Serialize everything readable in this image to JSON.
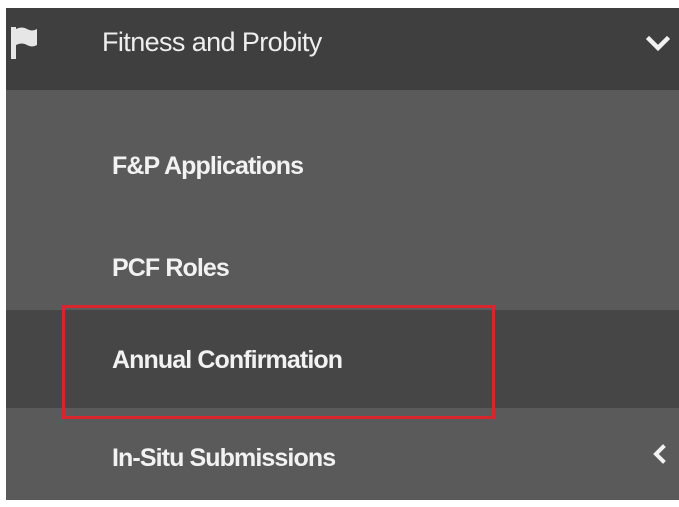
{
  "menu": {
    "header": {
      "title": "Fitness and Probity",
      "icon": "flag-icon",
      "expand_icon": "chevron-down-icon"
    },
    "items": [
      {
        "label": "F&P Applications"
      },
      {
        "label": "PCF Roles"
      },
      {
        "label": "Annual Confirmation",
        "highlighted": true
      },
      {
        "label": "In-Situ Submissions",
        "expand_icon": "chevron-left-icon"
      }
    ]
  },
  "colors": {
    "header_bg": "#3f3f3f",
    "menu_bg": "#5a5a5a",
    "selected_bg": "#464646",
    "highlight_border": "#d9262e",
    "text": "#f2f2f2"
  }
}
